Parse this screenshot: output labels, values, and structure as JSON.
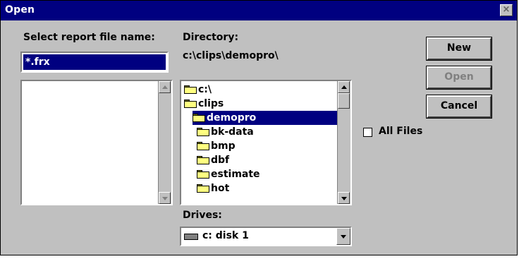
{
  "window": {
    "title": "Open",
    "close_glyph": "×"
  },
  "file_panel": {
    "label": "Select report file name:",
    "filename_value": "*.frx",
    "files": []
  },
  "directory_panel": {
    "label": "Directory:",
    "current_path": "c:\\clips\\demopro\\",
    "items": [
      {
        "name": "c:\\",
        "icon": "open-folder-icon",
        "selected": false
      },
      {
        "name": "clips",
        "icon": "open-folder-icon",
        "selected": false
      },
      {
        "name": "demopro",
        "icon": "open-folder-icon",
        "selected": true
      },
      {
        "name": "bk-data",
        "icon": "folder-icon",
        "selected": false
      },
      {
        "name": "bmp",
        "icon": "folder-icon",
        "selected": false
      },
      {
        "name": "dbf",
        "icon": "folder-icon",
        "selected": false
      },
      {
        "name": "estimate",
        "icon": "folder-icon",
        "selected": false
      },
      {
        "name": "hot",
        "icon": "folder-icon",
        "selected": false
      }
    ]
  },
  "drive_panel": {
    "label": "Drives:",
    "selected": "c: disk 1"
  },
  "buttons": {
    "new": "New",
    "open": "Open",
    "cancel": "Cancel"
  },
  "options": {
    "all_files_label": "All Files",
    "all_files_checked": false
  },
  "colors": {
    "title_bar": "#000080",
    "dialog_face": "#c0c0c0",
    "selection": "#000080"
  }
}
